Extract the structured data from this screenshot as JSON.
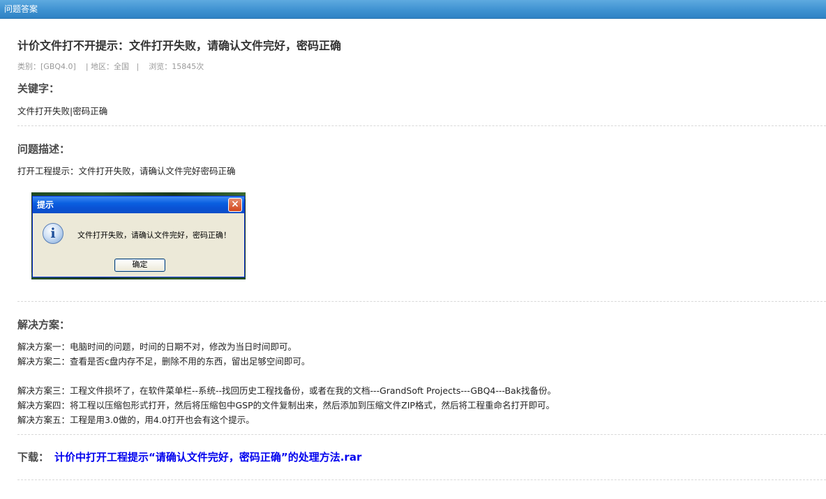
{
  "topbar": {
    "title": "问题答案"
  },
  "article": {
    "title": "计价文件打不开提示：文件打开失败，请确认文件完好，密码正确",
    "meta": {
      "category": "类别：[GBQ4.0]",
      "region": "| 地区：全国",
      "sep": "|",
      "views": "浏览：15845次"
    },
    "keywords_head": "关键字：",
    "keywords": "文件打开失败|密码正确",
    "description_head": "问题描述：",
    "description": "打开工程提示：文件打开失败，请确认文件完好密码正确",
    "dialog": {
      "title": "提示",
      "close": "×",
      "icon_glyph": "i",
      "message": "文件打开失败，请确认文件完好，密码正确！",
      "ok": "确定"
    },
    "solution_head": "解决方案：",
    "solutions": [
      "解决方案一：电脑时间的问题，时间的日期不对，修改为当日时间即可。",
      "解决方案二：查看是否c盘内存不足，删除不用的东西，留出足够空间即可。",
      "解决方案三：工程文件损坏了，在软件菜单栏--系统--找回历史工程找备份，或者在我的文档---GrandSoft Projects---GBQ4---Bak找备份。",
      "解决方案四：将工程以压缩包形式打开，然后将压缩包中GSP的文件复制出来，然后添加到压缩文件ZIP格式，然后将工程重命名打开即可。",
      "解决方案五：工程是用3.0做的，用4.0打开也会有这个提示。"
    ],
    "download": {
      "label": "下载：",
      "link": "计价中打开工程提示“请确认文件完好，密码正确”的处理方法.rar"
    }
  }
}
